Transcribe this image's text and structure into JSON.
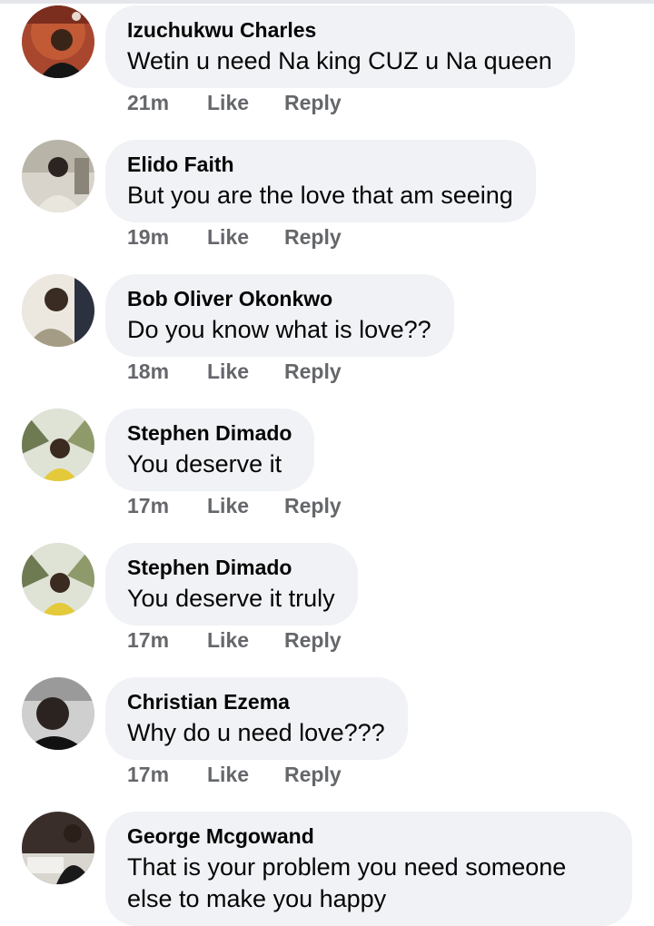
{
  "actions": {
    "like_label": "Like",
    "reply_label": "Reply"
  },
  "comments": [
    {
      "author": "Izuchukwu Charles",
      "text": "Wetin u need Na king CUZ u Na queen",
      "time": "21m"
    },
    {
      "author": "Elido Faith",
      "text": "But you are the love that am seeing",
      "time": "19m"
    },
    {
      "author": "Bob Oliver Okonkwo",
      "text": "Do you know what is love??",
      "time": "18m"
    },
    {
      "author": "Stephen Dimado",
      "text": "You deserve it",
      "time": "17m"
    },
    {
      "author": "Stephen Dimado",
      "text": "You deserve it truly",
      "time": "17m"
    },
    {
      "author": "Christian Ezema",
      "text": "Why do u need love???",
      "time": "17m"
    },
    {
      "author": "George Mcgowand",
      "text": "That is your problem you need someone else to make you happy"
    }
  ],
  "colors": {
    "bubble_bg": "#f0f2f5",
    "secondary_text": "#65676b",
    "primary_text": "#050505"
  }
}
